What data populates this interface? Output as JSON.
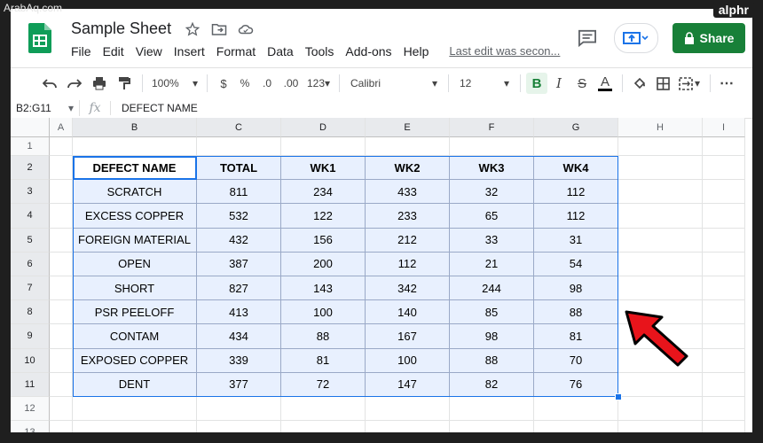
{
  "watermark_left": "ArabAq.com",
  "watermark_right": "alphr",
  "header": {
    "title": "Sample Sheet",
    "menu": [
      "File",
      "Edit",
      "View",
      "Insert",
      "Format",
      "Data",
      "Tools",
      "Add-ons",
      "Help"
    ],
    "last_edit": "Last edit was secon...",
    "share_label": "Share"
  },
  "toolbar": {
    "zoom": "100%",
    "currency": "$",
    "percent": "%",
    "dec_decrease": ".0",
    "dec_increase": ".00",
    "more_formats": "123",
    "font": "Calibri",
    "font_size": "12",
    "bold": "B",
    "italic": "I",
    "strike": "S",
    "text_color": "A"
  },
  "formula_bar": {
    "name_box": "B2:G11",
    "fx": "fx",
    "content": "DEFECT NAME"
  },
  "columns": [
    "A",
    "B",
    "C",
    "D",
    "E",
    "F",
    "G",
    "H",
    "I"
  ],
  "rows": [
    "1",
    "2",
    "3",
    "4",
    "5",
    "6",
    "7",
    "8",
    "9",
    "10",
    "11",
    "12",
    "13"
  ],
  "table": {
    "headers": [
      "DEFECT NAME",
      "TOTAL",
      "WK1",
      "WK2",
      "WK3",
      "WK4"
    ],
    "rows": [
      [
        "SCRATCH",
        "811",
        "234",
        "433",
        "32",
        "112"
      ],
      [
        "EXCESS COPPER",
        "532",
        "122",
        "233",
        "65",
        "112"
      ],
      [
        "FOREIGN MATERIAL",
        "432",
        "156",
        "212",
        "33",
        "31"
      ],
      [
        "OPEN",
        "387",
        "200",
        "112",
        "21",
        "54"
      ],
      [
        "SHORT",
        "827",
        "143",
        "342",
        "244",
        "98"
      ],
      [
        "PSR PEELOFF",
        "413",
        "100",
        "140",
        "85",
        "88"
      ],
      [
        "CONTAM",
        "434",
        "88",
        "167",
        "98",
        "81"
      ],
      [
        "EXPOSED COPPER",
        "339",
        "81",
        "100",
        "88",
        "70"
      ],
      [
        "DENT",
        "377",
        "72",
        "147",
        "82",
        "76"
      ]
    ]
  },
  "colors": {
    "selection_fill": "#e8f0fe",
    "selection_border": "#1a73e8",
    "share_green": "#188038",
    "arrow_red": "#e8141b"
  }
}
